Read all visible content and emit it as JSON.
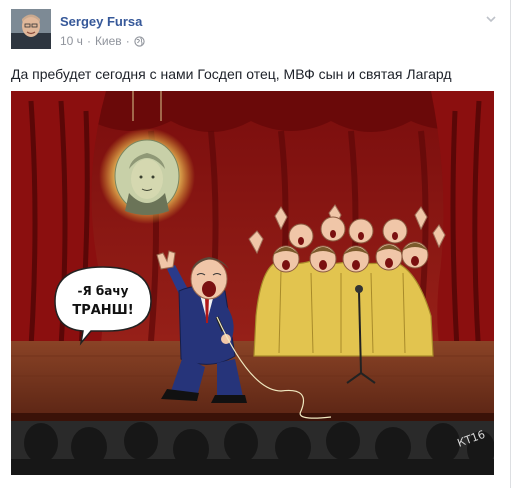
{
  "post": {
    "author": "Sergey Fursa",
    "time": "10 ч",
    "separator": "·",
    "location": "Киев",
    "separator2": "·",
    "privacy_icon": "globe-icon",
    "menu_icon": "chevron-down-icon",
    "text": "Да пребудет сегодня с нами Госдеп отец, МВФ сын и святая Лагард"
  },
  "image": {
    "speech_line1": "-Я бачу",
    "speech_line2": "ТРАНШ!",
    "signature": "КТ16"
  },
  "colors": {
    "link": "#365899",
    "meta": "#90949c",
    "curtain": "#8b0f0f",
    "halo": "#fff3a8",
    "robe": "#e2c44f"
  }
}
